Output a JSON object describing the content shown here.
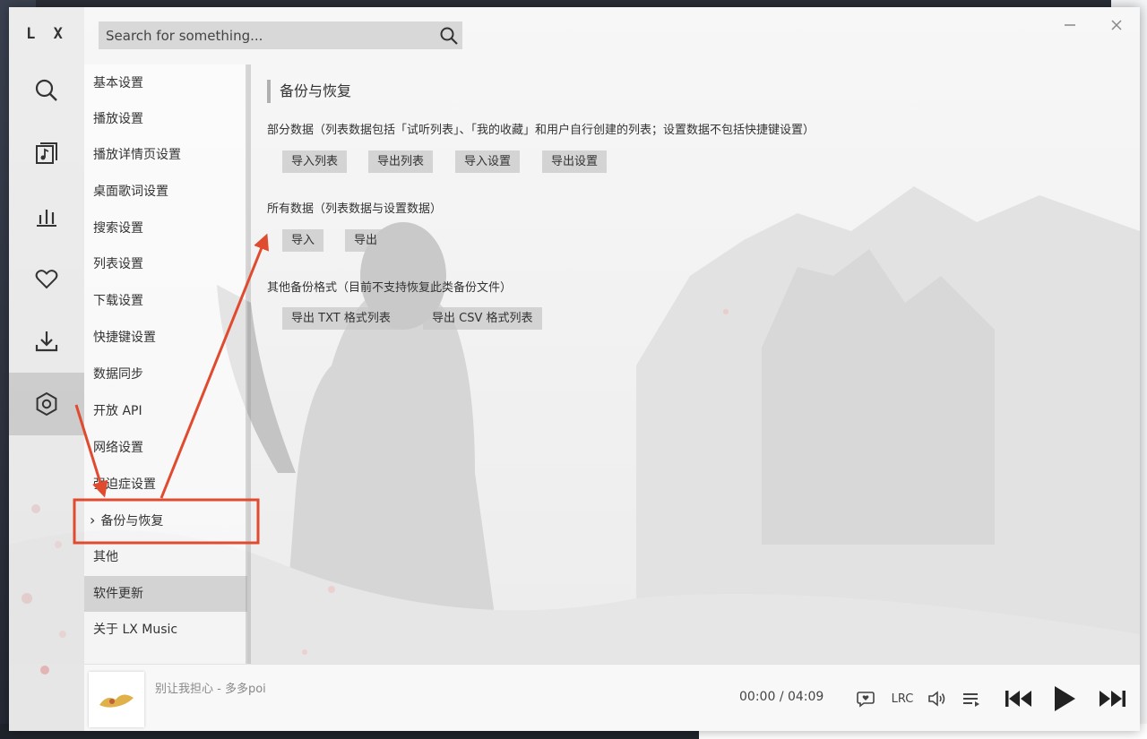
{
  "app": {
    "logo": "L X"
  },
  "search": {
    "placeholder": "Search for something..."
  },
  "nav": {
    "items": [
      "search-icon",
      "song-list-icon",
      "leaderboard-icon",
      "favorite-icon",
      "download-icon",
      "settings-icon"
    ],
    "active": "settings-icon"
  },
  "settings_menu": {
    "items": [
      {
        "label": "基本设置"
      },
      {
        "label": "播放设置"
      },
      {
        "label": "播放详情页设置"
      },
      {
        "label": "桌面歌词设置"
      },
      {
        "label": "搜索设置"
      },
      {
        "label": "列表设置"
      },
      {
        "label": "下载设置"
      },
      {
        "label": "快捷键设置"
      },
      {
        "label": "数据同步"
      },
      {
        "label": "开放 API"
      },
      {
        "label": "网络设置"
      },
      {
        "label": "强迫症设置"
      },
      {
        "label": "备份与恢复"
      },
      {
        "label": "其他"
      },
      {
        "label": "软件更新"
      },
      {
        "label": "关于 LX Music"
      }
    ],
    "current": "备份与恢复",
    "highlighted": "软件更新"
  },
  "content": {
    "title": "备份与恢复",
    "partial": {
      "desc": "部分数据（列表数据包括「试听列表」、「我的收藏」和用户自行创建的列表；设置数据不包括快捷键设置）",
      "buttons": [
        "导入列表",
        "导出列表",
        "导入设置",
        "导出设置"
      ]
    },
    "all": {
      "desc": "所有数据（列表数据与设置数据）",
      "buttons": [
        "导入",
        "导出"
      ]
    },
    "other": {
      "desc": "其他备份格式（目前不支持恢复此类备份文件）",
      "buttons": [
        "导出 TXT 格式列表",
        "导出 CSV 格式列表"
      ]
    }
  },
  "player": {
    "song": "别让我担心 - 多多poi",
    "current_time": "00:00",
    "separator": "/",
    "total_time": "04:09",
    "lrc_label": "LRC"
  },
  "colors": {
    "annotation": "#e04a2f",
    "accent": "#333333"
  }
}
